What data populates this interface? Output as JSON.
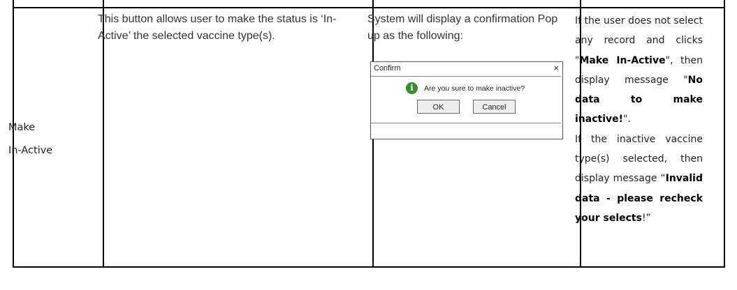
{
  "row": {
    "function_name_line1": "Make",
    "function_name_line2": "In-Active",
    "description": "This button allows user to make the status is ‘In-Active’ the selected vaccine type(s).",
    "system_response": "System will display a confirmation Pop up as the following:",
    "dialog": {
      "title": "Confirm",
      "close_glyph": "×",
      "icon": "info-icon",
      "icon_glyph": "i",
      "icon_color": "#3a8a2e",
      "message": "Are you sure to make inactive?",
      "ok_label": "OK",
      "cancel_label": "Cancel"
    },
    "rules": {
      "r1_a": "If the user does not select any record and clicks \"",
      "r1_b": "Make In-Active",
      "r1_c": "\", then display message \"",
      "r1_d": "No data to make inactive!",
      "r1_e": "\".",
      "r2_a": "If the inactive vaccine type(s) selected, then display message “",
      "r2_b": "Invalid data - please recheck your selects",
      "r2_c": "!”"
    }
  }
}
